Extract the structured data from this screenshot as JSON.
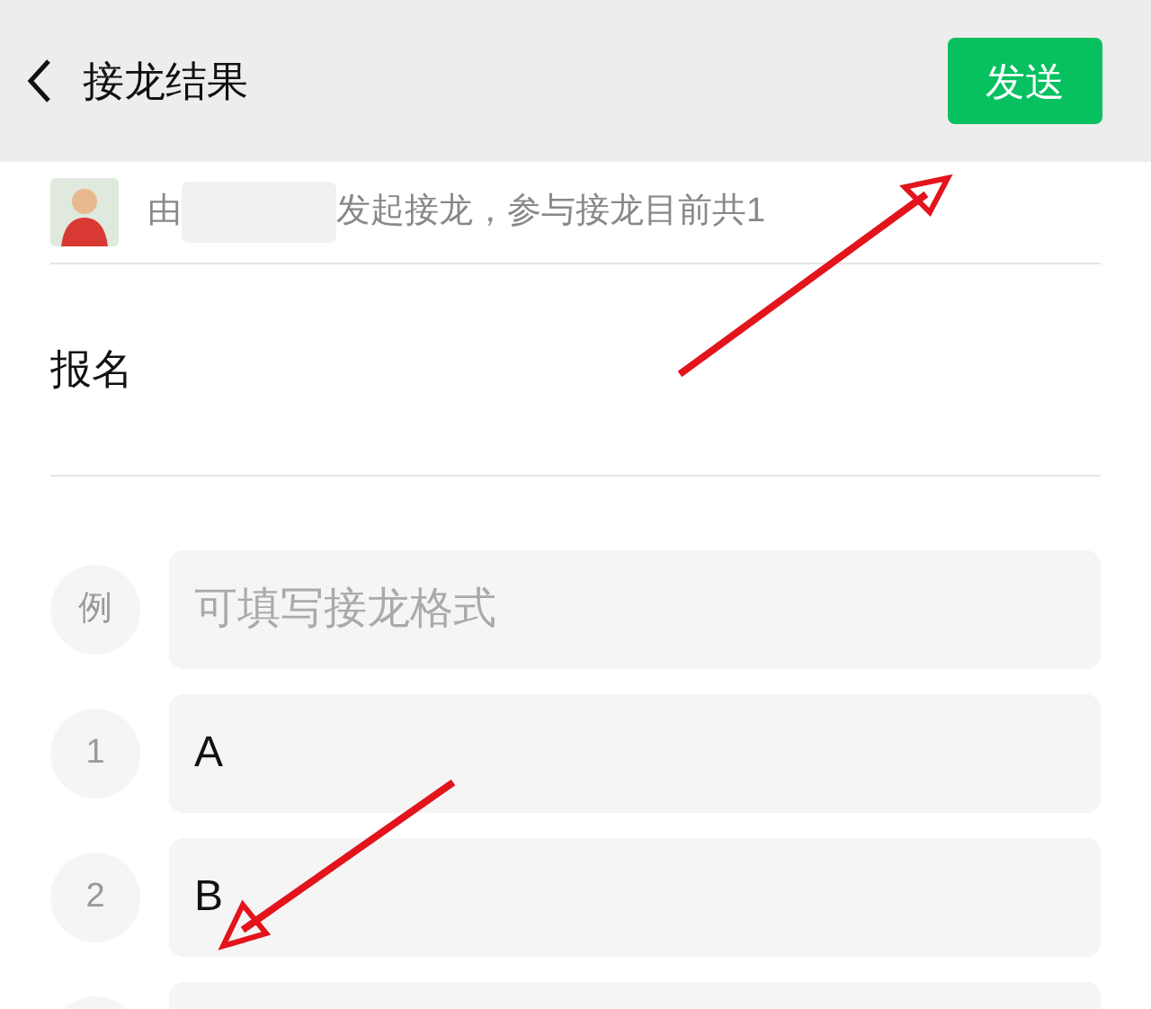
{
  "header": {
    "title": "接龙结果",
    "send_button": "发送"
  },
  "info": {
    "prefix": "由",
    "suffix": "发起接龙，参与接龙目前共1"
  },
  "section_title": "报名",
  "rows": [
    {
      "marker": "例",
      "placeholder": "可填写接龙格式"
    },
    {
      "marker": "1",
      "value": "A"
    },
    {
      "marker": "2",
      "value": "B"
    },
    {}
  ]
}
